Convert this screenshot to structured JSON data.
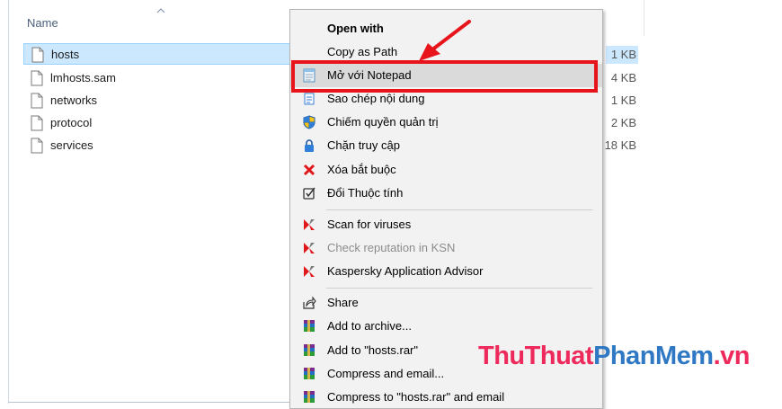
{
  "explorer": {
    "column_header": "Name",
    "files": [
      {
        "name": "hosts",
        "size": "1 KB",
        "selected": true
      },
      {
        "name": "lmhosts.sam",
        "size": "4 KB",
        "selected": false
      },
      {
        "name": "networks",
        "size": "1 KB",
        "selected": false
      },
      {
        "name": "protocol",
        "size": "2 KB",
        "selected": false
      },
      {
        "name": "services",
        "size": "18 KB",
        "selected": false
      }
    ]
  },
  "context_menu": {
    "items": [
      {
        "label": "Open with",
        "icon": "none",
        "bold": true
      },
      {
        "label": "Copy as Path",
        "icon": "none"
      },
      {
        "label": "Mở với Notepad",
        "icon": "notepad-icon",
        "highlighted": true
      },
      {
        "label": "Sao chép nội dung",
        "icon": "copy-content-icon"
      },
      {
        "label": "Chiếm quyền quản trị",
        "icon": "shield-icon"
      },
      {
        "label": "Chặn truy cập",
        "icon": "lock-icon"
      },
      {
        "label": "Xóa bắt buộc",
        "icon": "red-x-icon"
      },
      {
        "label": "Đổi Thuộc tính",
        "icon": "checkbox-icon"
      },
      {
        "label": "Scan for viruses",
        "icon": "kaspersky-icon"
      },
      {
        "label": "Check reputation in KSN",
        "icon": "kaspersky-icon",
        "disabled": true
      },
      {
        "label": "Kaspersky Application Advisor",
        "icon": "kaspersky-icon"
      },
      {
        "label": "Share",
        "icon": "share-icon"
      },
      {
        "label": "Add to archive...",
        "icon": "winrar-icon"
      },
      {
        "label": "Add to \"hosts.rar\"",
        "icon": "winrar-icon"
      },
      {
        "label": "Compress and email...",
        "icon": "winrar-icon"
      },
      {
        "label": "Compress to \"hosts.rar\" and email",
        "icon": "winrar-icon"
      }
    ]
  },
  "watermark": {
    "part1": "ThuThuat",
    "part2": "PhanMem",
    "part3": ".vn"
  },
  "colors": {
    "highlight_box": "#e8141c",
    "selection": "#cce8ff",
    "menu_bg": "#f2f2f2"
  }
}
